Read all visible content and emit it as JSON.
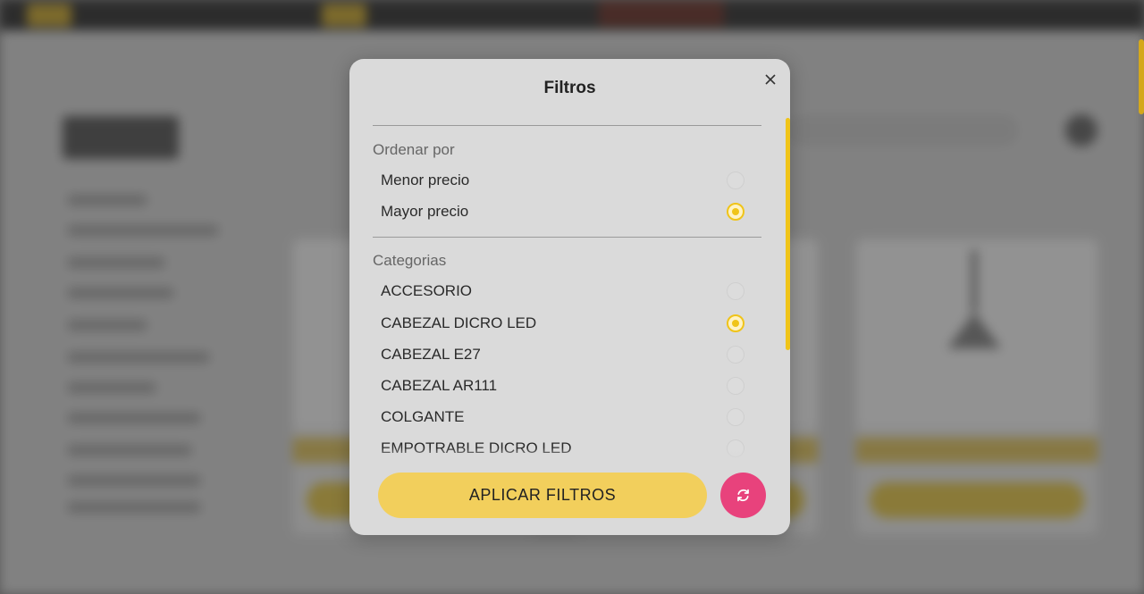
{
  "modal": {
    "title": "Filtros",
    "apply_label": "APLICAR FILTROS"
  },
  "sections": {
    "sort": {
      "label": "Ordenar por",
      "options": [
        {
          "label": "Menor precio",
          "checked": false
        },
        {
          "label": "Mayor precio",
          "checked": true
        }
      ]
    },
    "categories": {
      "label": "Categorias",
      "options": [
        {
          "label": "ACCESORIO",
          "checked": false
        },
        {
          "label": "CABEZAL DICRO LED",
          "checked": true
        },
        {
          "label": "CABEZAL E27",
          "checked": false
        },
        {
          "label": "CABEZAL AR111",
          "checked": false
        },
        {
          "label": "COLGANTE",
          "checked": false
        },
        {
          "label": "EMPOTRABLE DICRO LED",
          "checked": false
        }
      ]
    }
  },
  "icons": {
    "close": "close-icon",
    "reset": "refresh-icon"
  },
  "colors": {
    "accent": "#f2cf5c",
    "radio_checked": "#f0c419",
    "reset_button": "#e8427c"
  }
}
